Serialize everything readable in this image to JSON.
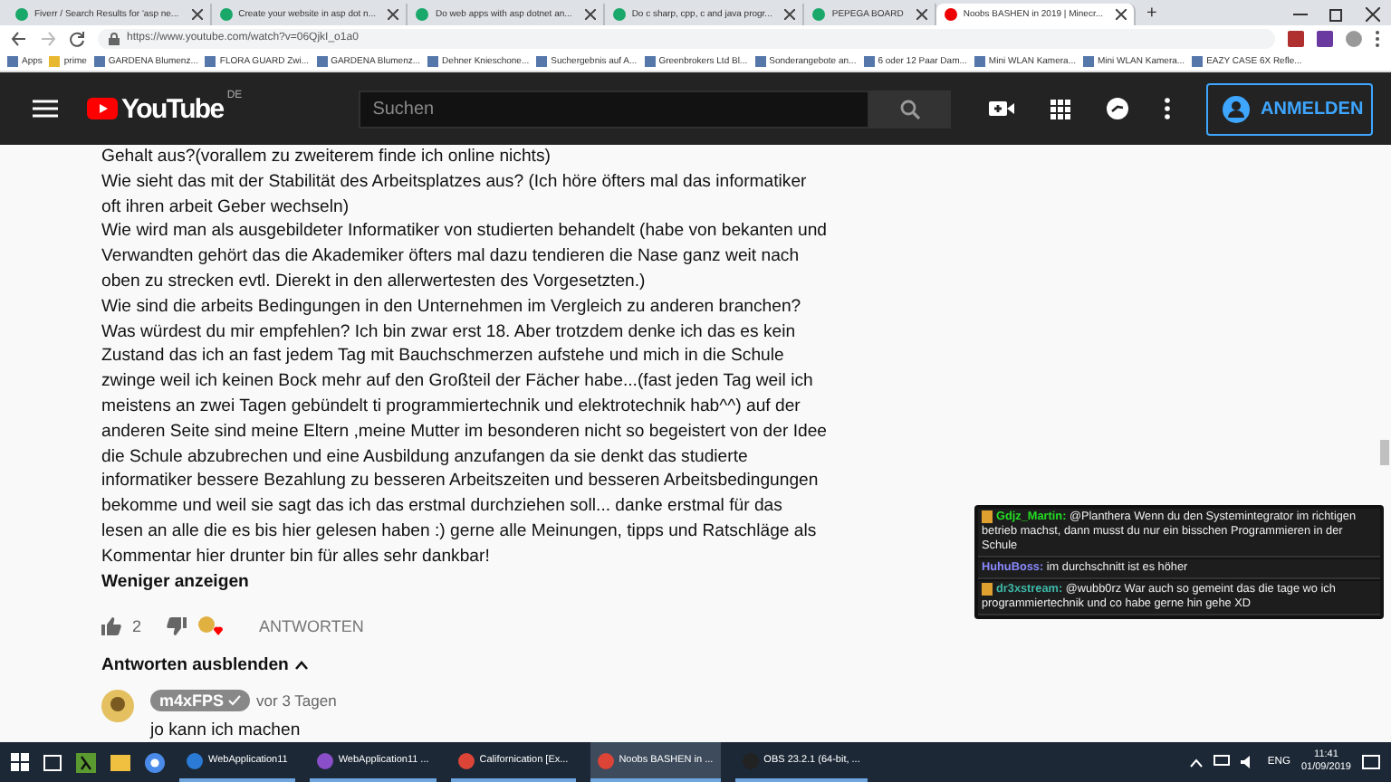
{
  "browser": {
    "tabs": [
      {
        "label": "Fiverr / Search Results for 'asp ne...",
        "selected": false
      },
      {
        "label": "Create your website in asp dot n...",
        "selected": false
      },
      {
        "label": "Do web apps with asp dotnet an...",
        "selected": false
      },
      {
        "label": "Do c sharp, cpp, c and java progr...",
        "selected": false
      },
      {
        "label": "PEPEGA BOARD",
        "selected": false
      },
      {
        "label": "Noobs BASHEN in 2019 | Minecr...",
        "selected": true
      }
    ],
    "new_tab": "+",
    "url": "https://www.youtube.com/watch?v=06QjkI_o1a0",
    "bookmarks": [
      "Apps",
      "prime",
      "GARDENA Blumenz...",
      "FLORA GUARD Zwi...",
      "GARDENA Blumenz...",
      "Dehner Knieschone...",
      "Suchergebnis auf A...",
      "Greenbrokers Ltd Bl...",
      "Sonderangebote an...",
      "6 oder 12 Paar Dam...",
      "Mini WLAN Kamera...",
      "Mini WLAN Kamera...",
      "EAZY CASE 6X Refle..."
    ]
  },
  "header": {
    "logo": "YouTube",
    "region": "DE",
    "search": {
      "placeholder": "Suchen"
    },
    "sign_in": "ANMELDEN"
  },
  "comment": {
    "lines": [
      "Gehalt aus?(vorallem zu zweiterem finde ich online nichts)",
      "Wie sieht das mit der Stabilität des Arbeitsplatzes  aus? (Ich höre öfters mal das informatiker",
      "oft ihren arbeit Geber wechseln)",
      "Wie wird man als ausgebildeter Informatiker von studierten behandelt (habe von bekanten und",
      "Verwandten gehört das die Akademiker öfters mal dazu tendieren die Nase ganz weit nach",
      "oben zu strecken evtl. Dierekt in den allerwertesten des Vorgesetzten.)",
      "Wie sind die arbeits Bedingungen in den Unternehmen im Vergleich zu anderen branchen?",
      "Was würdest du mir empfehlen? Ich bin zwar erst 18. Aber trotzdem denke ich das es kein",
      "Zustand das ich an fast jedem Tag mit Bauchschmerzen aufstehe und mich in die Schule",
      "zwinge weil ich keinen Bock mehr auf den Großteil der Fächer habe...(fast jeden Tag weil ich",
      "meistens an zwei Tagen gebündelt ti programmiertechnik und elektrotechnik hab^^) auf der",
      "anderen Seite sind meine Eltern ,meine Mutter im besonderen nicht so begeistert  von der Idee",
      "die Schule abzubrechen und eine Ausbildung anzufangen da sie denkt das studierte",
      "informatiker bessere Bezahlung zu besseren Arbeitszeiten und besseren Arbeitsbedingungen",
      "bekomme  und weil sie sagt das ich das erstmal durchziehen soll... danke erstmal für das",
      "lesen an alle die es   bis hier gelesen haben :) gerne alle Meinungen, tipps und Ratschläge als",
      "Kommentar  hier  drunter bin für alles sehr dankbar!"
    ],
    "show_less": "Weniger anzeigen",
    "likes": "2",
    "reply": "ANTWORTEN",
    "hide_replies": "Antworten ausblenden",
    "replies": [
      {
        "author": "m4xFPS",
        "time": "vor 3 Tagen",
        "text": "jo kann ich machen"
      }
    ]
  },
  "chat": [
    {
      "user": "Gdjz_Martin:",
      "color": "#22dd22",
      "badge": true,
      "text": "@Planthera Wenn du den Systemintegrator im richtigen betrieb machst, dann musst du nur ein bisschen Programmieren in der Schule"
    },
    {
      "user": "HuhuBoss:",
      "color": "#8a8aff",
      "badge": false,
      "text": "im durchschnitt ist es höher"
    },
    {
      "user": "dr3xstream:",
      "color": "#3cb8a8",
      "badge": true,
      "text": "@wubb0rz War auch so gemeint das die tage wo ich programmiertechnik und co habe gerne hin gehe XD"
    }
  ],
  "taskbar": {
    "windows": [
      {
        "label": "WebApplication11",
        "selected": false
      },
      {
        "label": "WebApplication11 ...",
        "selected": false
      },
      {
        "label": "Californication [Ex...",
        "selected": false
      },
      {
        "label": "Noobs BASHEN in ...",
        "selected": true
      },
      {
        "label": "OBS 23.2.1 (64-bit, ...",
        "selected": false
      }
    ],
    "language": "ENG",
    "time": "11:41",
    "date": "01/09/2019"
  }
}
